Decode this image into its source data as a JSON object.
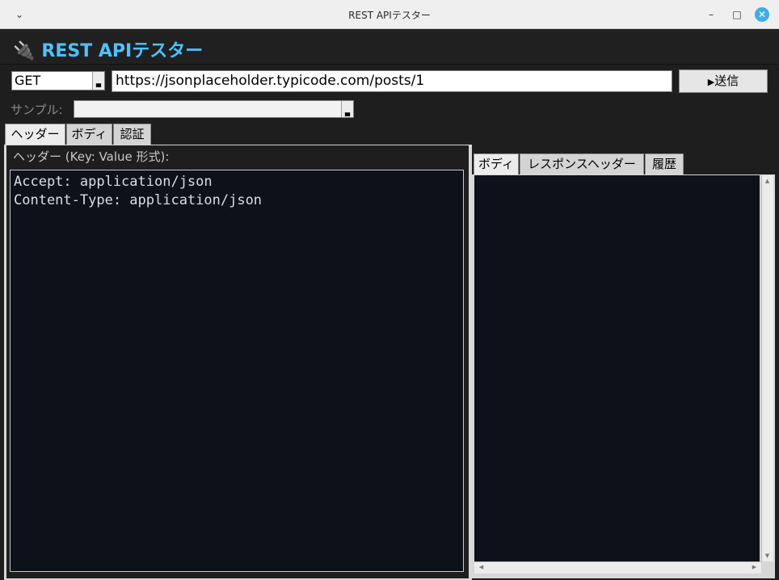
{
  "window": {
    "title": "REST APIテスター",
    "controls": {
      "collapse": "⌄",
      "minimize": "–",
      "maximize": "□",
      "close": "✕"
    }
  },
  "app": {
    "icon": "plug-icon",
    "title": "REST APIテスター",
    "accent_color": "#4fc1ff"
  },
  "request": {
    "method": "GET",
    "url": "https://jsonplaceholder.typicode.com/posts/1",
    "send_label": "送信",
    "send_icon": "play-triangle-icon"
  },
  "sample": {
    "label": "サンプル:",
    "value": ""
  },
  "request_tabs": [
    {
      "label": "ヘッダー",
      "active": true
    },
    {
      "label": "ボディ",
      "active": false
    },
    {
      "label": "認証",
      "active": false
    }
  ],
  "headers_panel": {
    "label": "ヘッダー (Key: Value 形式):",
    "lines": [
      "Accept: application/json",
      "Content-Type: application/json"
    ]
  },
  "response_tabs": [
    {
      "label": "ボディ",
      "active": true
    },
    {
      "label": "レスポンスヘッダー",
      "active": false
    },
    {
      "label": "履歴",
      "active": false
    }
  ],
  "response_body": ""
}
